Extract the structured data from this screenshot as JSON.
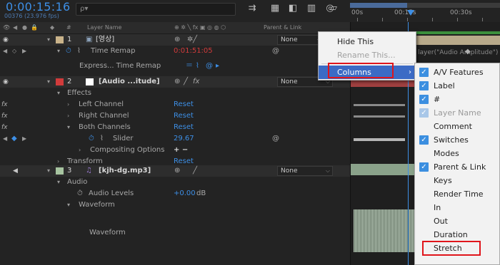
{
  "header": {
    "timecode": "0:00:15:16",
    "fps": "00376 (23.976 fps)",
    "search_placeholder": "ρ▾"
  },
  "ruler": {
    "labels": [
      "00s",
      "00:15s",
      "00:30s"
    ]
  },
  "columns": {
    "layer_name": "Layer Name",
    "parent_link": "Parent & Link"
  },
  "layers": {
    "l1": {
      "num": "1",
      "name": "[영상]",
      "parent": "None",
      "time_remap": "Time Remap",
      "time_remap_value": "0:01:51:05",
      "expression": "Express... Time Remap"
    },
    "l2": {
      "num": "2",
      "name": "[Audio ...itude]",
      "parent": "None",
      "effects": "Effects",
      "left": "Left Channel",
      "right": "Right Channel",
      "both": "Both Channels",
      "slider": "Slider",
      "slider_value": "29.67",
      "compositing": "Compositing Options",
      "transform": "Transform",
      "reset": "Reset",
      "plus_minus": "+ −"
    },
    "l3": {
      "num": "3",
      "name": "[kjh-dg.mp3]",
      "parent": "None",
      "audio": "Audio",
      "levels": "Audio Levels",
      "levels_value": "+0.00",
      "levels_unit": "dB",
      "waveform": "Waveform",
      "waveform2": "Waveform"
    }
  },
  "timeline": {
    "expression_label": "layer(\"Audio Amplitude\")"
  },
  "context_menu": {
    "items": [
      {
        "label": "Hide This",
        "enabled": true
      },
      {
        "label": "Rename This...",
        "enabled": false
      },
      {
        "label": "Columns",
        "enabled": true,
        "highlighted": true,
        "submenu": true
      }
    ]
  },
  "columns_menu": {
    "items": [
      {
        "label": "A/V Features",
        "checked": true,
        "enabled": true
      },
      {
        "label": "Label",
        "checked": true,
        "enabled": true
      },
      {
        "label": "#",
        "checked": true,
        "enabled": true
      },
      {
        "label": "Layer Name",
        "checked": true,
        "enabled": false
      },
      {
        "label": "Comment",
        "checked": false,
        "enabled": true
      },
      {
        "label": "Switches",
        "checked": true,
        "enabled": true
      },
      {
        "label": "Modes",
        "checked": false,
        "enabled": true
      },
      {
        "label": "Parent & Link",
        "checked": true,
        "enabled": true
      },
      {
        "label": "Keys",
        "checked": false,
        "enabled": true
      },
      {
        "label": "Render Time",
        "checked": false,
        "enabled": true
      },
      {
        "label": "In",
        "checked": false,
        "enabled": true
      },
      {
        "label": "Out",
        "checked": false,
        "enabled": true
      },
      {
        "label": "Duration",
        "checked": false,
        "enabled": true
      },
      {
        "label": "Stretch",
        "checked": false,
        "enabled": true
      }
    ]
  },
  "colors": {
    "accent_blue": "#3d8fe6",
    "menu_highlight": "#3c6bc5",
    "annotation_red": "#e0151b",
    "label_layer1": "#c9b38a",
    "label_layer2": "#d13b3b",
    "label_layer3": "#a7c4a0",
    "checkbox_blue": "#3c8fe0"
  },
  "icons": {
    "search": "magnifier-icon",
    "tb1": "comp-flowchart-icon",
    "tb2": "draft-3d-icon",
    "tb3": "shy-layers-icon",
    "tb4": "frame-blending-icon",
    "tb5": "motion-blur-icon",
    "tb6": "graph-editor-icon"
  }
}
